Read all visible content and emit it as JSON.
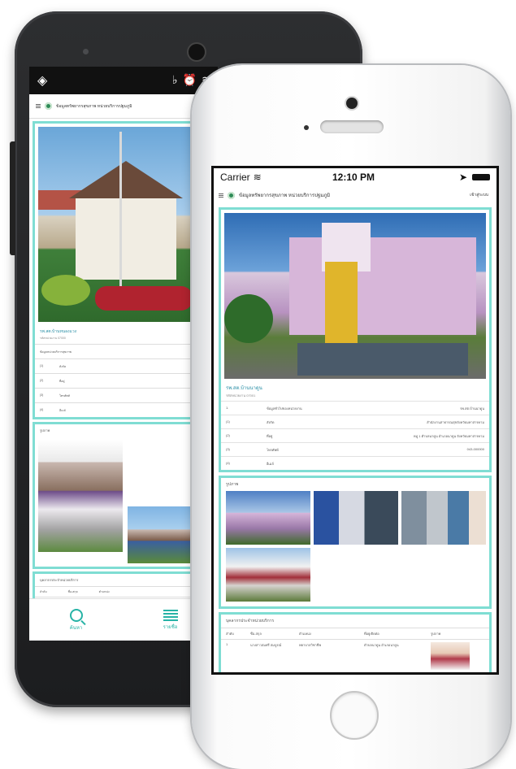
{
  "android": {
    "status_icons": [
      "location-icon",
      "mute-icon",
      "alarm-icon",
      "wifi-icon"
    ],
    "header_title": "ข้อมูลทรัพยากรสุขภาพ หน่วยบริการปฐมภูมิ",
    "facility_name": "รพ.สต.บ้านหนองแวง",
    "facility_sub": "รหัสหน่วยงาน 07000",
    "info_heading": "ข้อมูลหน่วยบริการสุขภาพ",
    "info_rows": [
      {
        "no": "(1)",
        "label": "สังกัด"
      },
      {
        "no": "(2)",
        "label": "ที่อยู่"
      },
      {
        "no": "(3)",
        "label": "โทรศัพท์"
      },
      {
        "no": "(4)",
        "label": "อีเมล์"
      }
    ],
    "gallery_title": "รูปภาพ",
    "staff_title": "บุคลากรประจำหน่วยบริการ",
    "staff_cols": [
      "ลำดับ",
      "ชื่อ-สกุล",
      "ตำแหน่ง"
    ],
    "staff_first_row": [
      "1",
      "นางสาวสมศรี สมบูรณ์"
    ],
    "nav_search": "ค้นหา",
    "nav_list": "รายชื่อ"
  },
  "iphone": {
    "carrier": "Carrier",
    "time": "12:10 PM",
    "header_title": "ข้อมูลทรัพยากรสุขภาพ หน่วยบริการปฐมภูมิ",
    "login": "เข้าสู่ระบบ",
    "facility_name": "รพ.สต.บ้านนาดูน",
    "facility_sub": "รหัสหน่วยงาน 07001",
    "info_rows": [
      {
        "no": "1.",
        "label": "ข้อมูลทั่วไปของหน่วยงาน",
        "value": "รพ.สต.บ้านนาดูน"
      },
      {
        "no": "(1)",
        "label": "สังกัด",
        "value": "สำนักงานสาธารณสุขจังหวัดมหาสารคาม"
      },
      {
        "no": "(2)",
        "label": "ที่อยู่",
        "value": "หมู่ 1 ตำบลนาดูน อำเภอนาดูน จังหวัดมหาสารคาม"
      },
      {
        "no": "(3)",
        "label": "โทรศัพท์",
        "value": "043-000000"
      },
      {
        "no": "(4)",
        "label": "อีเมล์",
        "value": ""
      }
    ],
    "gallery_title": "รูปภาพ",
    "staff_title": "บุคลากรประจำหน่วยบริการ",
    "staff_cols": [
      "ลำดับ",
      "ชื่อ-สกุล",
      "ตำแหน่ง",
      "ที่อยู่/ติดต่อ",
      "รูปภาพ"
    ],
    "staff_first_row": [
      "1",
      "นางสาวสมศรี สมบูรณ์",
      "พยาบาลวิชาชีพ",
      "ตำบลนาดูน อำเภอนาดูน"
    ]
  }
}
